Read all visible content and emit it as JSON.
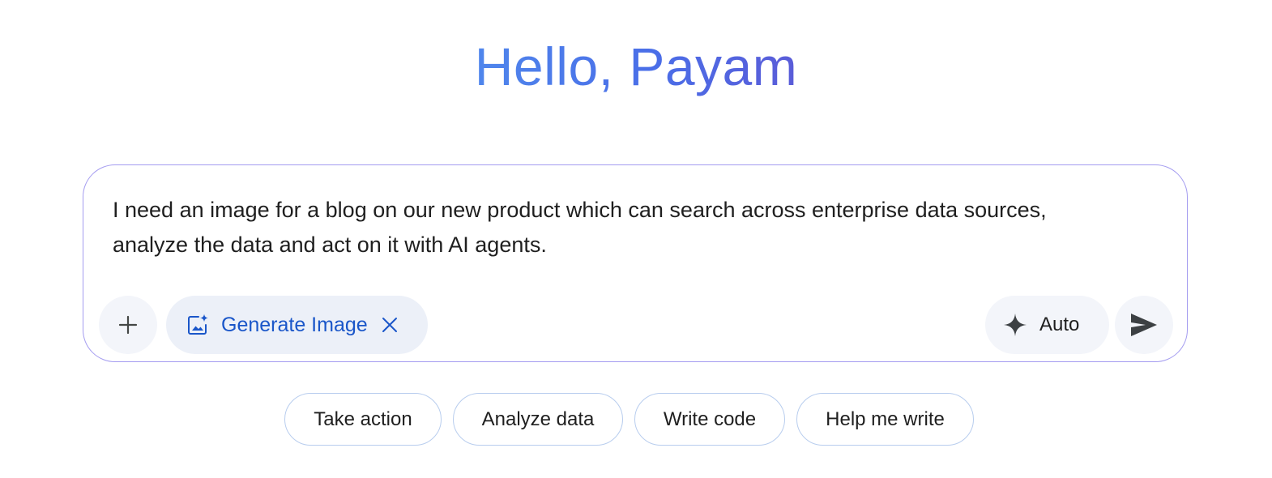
{
  "greeting": "Hello, Payam",
  "composer": {
    "prompt_text": "I need an image for a blog on our new product which can search across enterprise data sources,\nanalyze the data and act on it with AI agents.",
    "add_button_icon": "plus-icon",
    "tool_chip": {
      "icon": "image-sparkle-icon",
      "label": "Generate Image",
      "remove_icon": "close-icon"
    },
    "model_selector": {
      "icon": "sparkle-icon",
      "label": "Auto"
    },
    "send_icon": "send-icon"
  },
  "suggestions": [
    {
      "label": "Take action"
    },
    {
      "label": "Analyze data"
    },
    {
      "label": "Write code"
    },
    {
      "label": "Help me write"
    }
  ],
  "colors": {
    "greeting_gradient_start": "#4f86ec",
    "greeting_gradient_end": "#5a5cd8",
    "composer_border": "#a49cf0",
    "chip_border": "#b8cdee",
    "tool_chip_background": "#ecf0f8",
    "tool_chip_text": "#1a56c9",
    "button_background": "#f3f5fa"
  }
}
